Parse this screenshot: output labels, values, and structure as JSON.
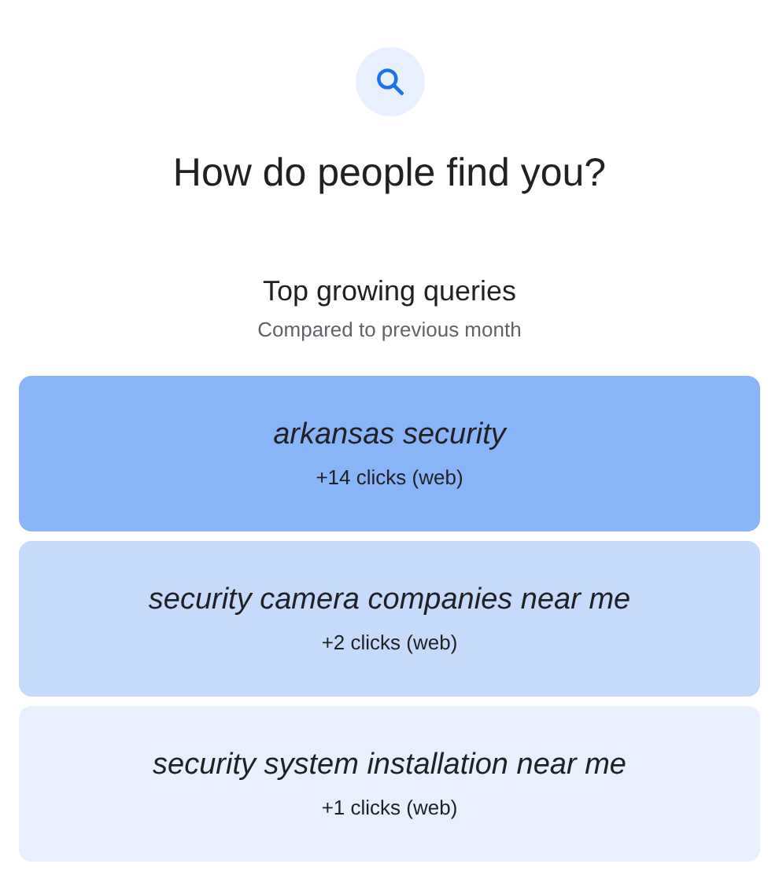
{
  "title": "How do people find you?",
  "section": {
    "title": "Top growing queries",
    "subtitle": "Compared to previous month"
  },
  "queries": [
    {
      "query": "arkansas security",
      "clicks": "+14 clicks (web)",
      "color": "#8ab4f8"
    },
    {
      "query": "security camera companies near me",
      "clicks": "+2 clicks (web)",
      "color": "#c6dafc"
    },
    {
      "query": "security system installation near me",
      "clicks": "+1 clicks (web)",
      "color": "#e8f0fe"
    }
  ]
}
